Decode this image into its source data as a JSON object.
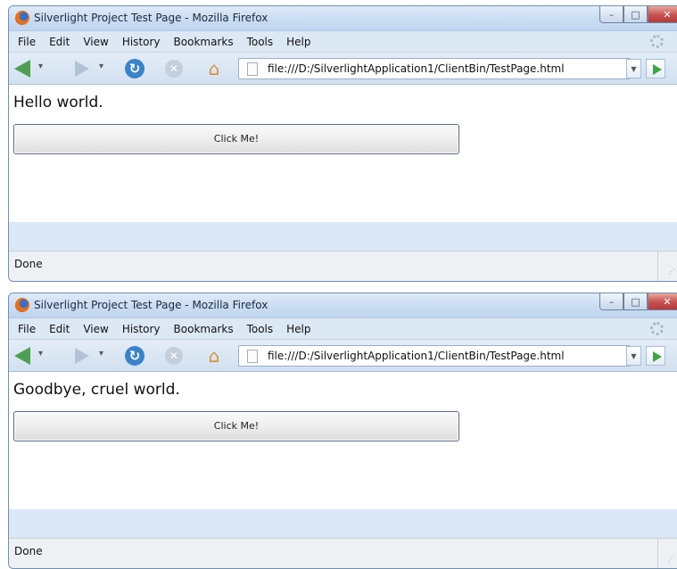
{
  "windows": [
    {
      "title": "Silverlight Project Test Page - Mozilla Firefox",
      "menu": [
        "File",
        "Edit",
        "View",
        "History",
        "Bookmarks",
        "Tools",
        "Help"
      ],
      "url": "file:///D:/SilverlightApplication1/ClientBin/TestPage.html",
      "page_text": "Hello world.",
      "button_label": "Click Me!",
      "status": "Done"
    },
    {
      "title": "Silverlight Project Test Page - Mozilla Firefox",
      "menu": [
        "File",
        "Edit",
        "View",
        "History",
        "Bookmarks",
        "Tools",
        "Help"
      ],
      "url": "file:///D:/SilverlightApplication1/ClientBin/TestPage.html",
      "page_text": "Goodbye, cruel world.",
      "button_label": "Click Me!",
      "status": "Done"
    }
  ],
  "icons": {
    "app": "firefox-icon",
    "back": "back-arrow-icon",
    "forward": "forward-arrow-icon",
    "reload": "reload-icon",
    "stop": "stop-icon",
    "home": "home-icon",
    "page": "page-icon",
    "go": "go-icon"
  },
  "colors": {
    "window_frame": "#6f8fb3",
    "close_button": "#c75050",
    "back_arrow": "#4f9e55",
    "go_arrow": "#3fa443"
  }
}
